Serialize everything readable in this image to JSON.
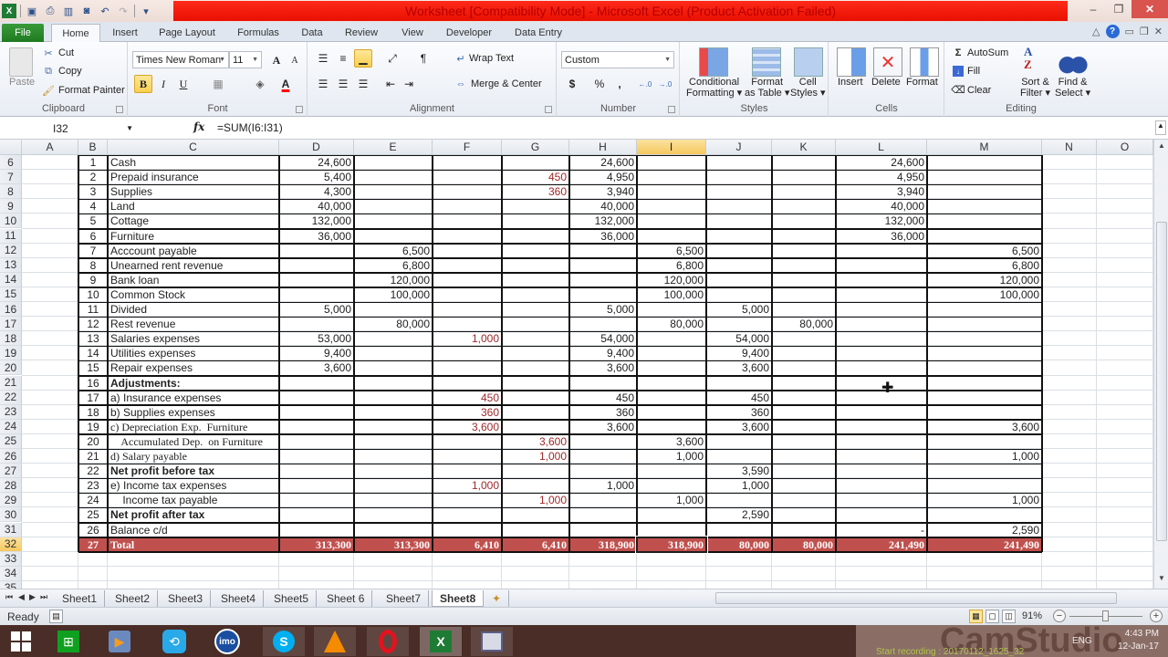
{
  "window": {
    "title": "Worksheet  [Compatibility Mode]  -  Microsoft Excel (Product Activation Failed)",
    "minimize": "–",
    "restore": "❐",
    "close": "✕"
  },
  "ribbon_tabs": [
    "File",
    "Home",
    "Insert",
    "Page Layout",
    "Formulas",
    "Data",
    "Review",
    "View",
    "Developer",
    "Data Entry"
  ],
  "active_tab": "Home",
  "clipboard": {
    "paste": "Paste",
    "cut": "Cut",
    "copy": "Copy",
    "format_painter": "Format Painter",
    "label": "Clipboard"
  },
  "font": {
    "name": "Times New Roman",
    "size": "11",
    "bold": "B",
    "italic": "I",
    "underline": "U",
    "grow": "A",
    "shrink": "A",
    "color_letter": "A",
    "font_color": "#ff0000",
    "label": "Font"
  },
  "alignment": {
    "wrap_text": "Wrap Text",
    "merge_center": "Merge & Center",
    "label": "Alignment"
  },
  "number": {
    "format": "Custom",
    "currency": "$",
    "percent": "%",
    "comma": ",",
    "inc_decimal": "←.0 .00",
    "dec_decimal": ".00 →.0",
    "label": "Number"
  },
  "styles": {
    "conditional": [
      "Conditional",
      "Formatting"
    ],
    "format_table": [
      "Format",
      "as Table"
    ],
    "cell_styles": [
      "Cell",
      "Styles"
    ],
    "label": "Styles"
  },
  "cells": {
    "insert": "Insert",
    "delete": "Delete",
    "format": "Format",
    "label": "Cells"
  },
  "editing": {
    "autosum": "AutoSum",
    "fill": "Fill",
    "clear": "Clear",
    "sort_filter": [
      "Sort &",
      "Filter"
    ],
    "find_select": [
      "Find &",
      "Select"
    ],
    "label": "Editing"
  },
  "formula_bar": {
    "name_box": "I32",
    "fx": "fx",
    "formula": "=SUM(I6:I31)"
  },
  "columns": [
    "A",
    "B",
    "C",
    "D",
    "E",
    "F",
    "G",
    "H",
    "I",
    "J",
    "K",
    "L",
    "M",
    "N",
    "O"
  ],
  "selected_column": "I",
  "selected_row": "32",
  "rows": [
    {
      "r": "6",
      "B": "1",
      "C": "Cash",
      "D": "24,600",
      "H": "24,600",
      "L": "24,600"
    },
    {
      "r": "7",
      "B": "2",
      "C": "Prepaid insurance",
      "D": "5,400",
      "G": "450",
      "H": "4,950",
      "L": "4,950"
    },
    {
      "r": "8",
      "B": "3",
      "C": "Supplies",
      "D": "4,300",
      "G": "360",
      "H": "3,940",
      "L": "3,940"
    },
    {
      "r": "9",
      "B": "4",
      "C": "Land",
      "D": "40,000",
      "H": "40,000",
      "L": "40,000"
    },
    {
      "r": "10",
      "B": "5",
      "C": "Cottage",
      "D": "132,000",
      "H": "132,000",
      "L": "132,000"
    },
    {
      "r": "11",
      "B": "6",
      "C": "Furniture",
      "D": "36,000",
      "H": "36,000",
      "L": "36,000"
    },
    {
      "r": "12",
      "B": "7",
      "C": "Acccount payable",
      "E": "6,500",
      "I": "6,500",
      "M": "6,500"
    },
    {
      "r": "13",
      "B": "8",
      "C": "Unearned rent revenue",
      "E": "6,800",
      "I": "6,800",
      "M": "6,800"
    },
    {
      "r": "14",
      "B": "9",
      "C": "Bank loan",
      "E": "120,000",
      "I": "120,000",
      "M": "120,000"
    },
    {
      "r": "15",
      "B": "10",
      "C": "Common Stock",
      "E": "100,000",
      "I": "100,000",
      "M": "100,000"
    },
    {
      "r": "16",
      "B": "11",
      "C": "Divided",
      "D": "5,000",
      "H": "5,000",
      "J": "5,000"
    },
    {
      "r": "17",
      "B": "12",
      "C": "Rest revenue",
      "E": "80,000",
      "I": "80,000",
      "K": "80,000"
    },
    {
      "r": "18",
      "B": "13",
      "C": "Salaries expenses",
      "D": "53,000",
      "F": "1,000",
      "H": "54,000",
      "J": "54,000"
    },
    {
      "r": "19",
      "B": "14",
      "C": "Utilities expenses",
      "D": "9,400",
      "H": "9,400",
      "J": "9,400"
    },
    {
      "r": "20",
      "B": "15",
      "C": "Repair expenses",
      "D": "3,600",
      "H": "3,600",
      "J": "3,600"
    },
    {
      "r": "21",
      "B": "16",
      "C": "Adjustments:",
      "bold": true
    },
    {
      "r": "22",
      "B": "17",
      "C": "a) Insurance expenses",
      "F": "450",
      "H": "450",
      "J": "450"
    },
    {
      "r": "23",
      "B": "18",
      "C": "b) Supplies expenses",
      "F": "360",
      "H": "360",
      "J": "360"
    },
    {
      "r": "24",
      "B": "19",
      "C": "c) Depreciation Exp.  Furniture",
      "serif": true,
      "F": "3,600",
      "H": "3,600",
      "J": "3,600",
      "M": "3,600"
    },
    {
      "r": "25",
      "B": "20",
      "C": "    Accumulated Dep.  on Furniture",
      "serif": true,
      "G": "3,600",
      "I": "3,600"
    },
    {
      "r": "26",
      "B": "21",
      "C": "d) Salary payable",
      "serif": true,
      "G": "1,000",
      "I": "1,000",
      "M": "1,000"
    },
    {
      "r": "27",
      "B": "22",
      "C": "Net profit before tax",
      "bold": true,
      "J": "3,590"
    },
    {
      "r": "28",
      "B": "23",
      "C": "e) Income tax expenses",
      "F": "1,000",
      "H": "1,000",
      "J": "1,000"
    },
    {
      "r": "29",
      "B": "24",
      "C": "    Income tax payable",
      "G": "1,000",
      "I": "1,000",
      "M": "1,000"
    },
    {
      "r": "30",
      "B": "25",
      "C": "Net profit after tax",
      "bold": true,
      "J": "2,590"
    },
    {
      "r": "31",
      "B": "26",
      "C": "Balance c/d",
      "L": "-",
      "M": "2,590"
    },
    {
      "r": "32",
      "B": "27",
      "C": "Total",
      "total": true,
      "D": "313,300",
      "E": "313,300",
      "F": "6,410",
      "G": "6,410",
      "H": "318,900",
      "I": "318,900",
      "J": "80,000",
      "K": "80,000",
      "L": "241,490",
      "M": "241,490"
    },
    {
      "r": "33"
    },
    {
      "r": "34"
    },
    {
      "r": "35"
    }
  ],
  "red_columns": [
    "F",
    "G"
  ],
  "colors": {
    "total_row": "#c0504d",
    "adjust_text": "#a0282a",
    "title_bar": "#ff1a0a"
  },
  "sheets": [
    "Sheet1",
    "Sheet2",
    "Sheet3",
    "Sheet4",
    "Sheet5",
    "Sheet 6",
    "Sheet7",
    "Sheet8"
  ],
  "active_sheet": "Sheet8",
  "status": {
    "mode": "Ready",
    "zoom": "91%"
  },
  "taskbar": {
    "apps": [
      "start",
      "store",
      "media-player",
      "shareit",
      "imo",
      "skype",
      "vlc",
      "opera",
      "excel",
      "camstudio"
    ],
    "lang": "ENG",
    "time": "4:43 PM",
    "date": "12-Jan-17",
    "recording": "Start recording : 20170112_1625_32",
    "watermark": "CamStudio"
  }
}
